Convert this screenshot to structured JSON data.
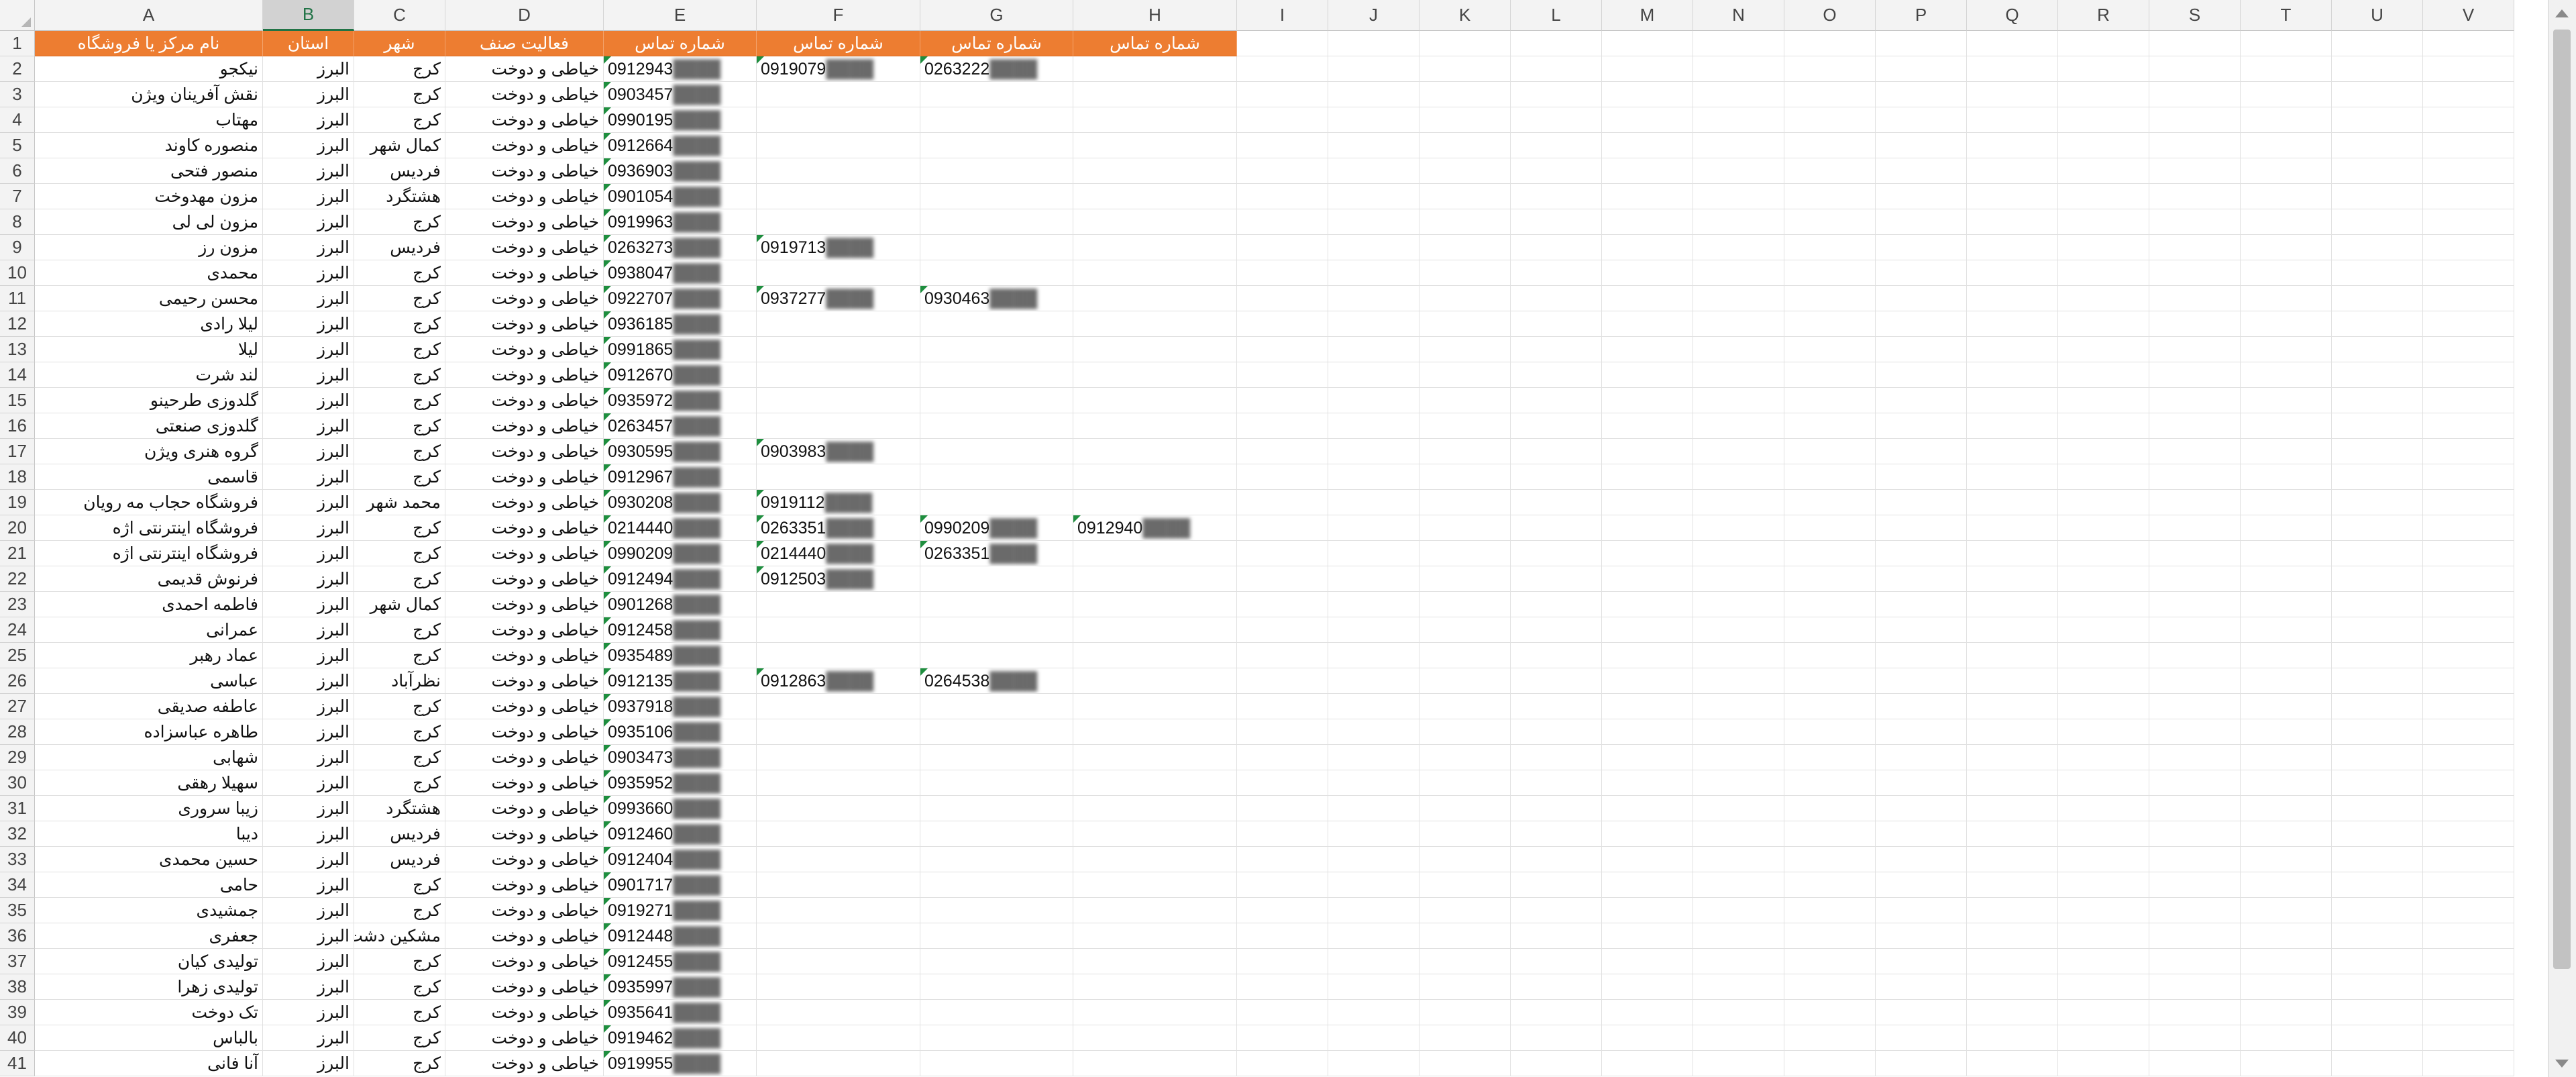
{
  "columns": [
    "A",
    "B",
    "C",
    "D",
    "E",
    "F",
    "G",
    "H",
    "I",
    "J",
    "K",
    "L",
    "M",
    "N",
    "O",
    "P",
    "Q",
    "R",
    "S",
    "T",
    "U",
    "V"
  ],
  "selected_column": "B",
  "header": [
    "نام مرکز یا فروشگاه",
    "استان",
    "شهر",
    "فعالیت صنف",
    "شماره تماس",
    "شماره تماس",
    "شماره تماس",
    "شماره تماس"
  ],
  "rows": [
    {
      "n": "2",
      "a": "نیکجو",
      "b": "البرز",
      "c": "کرج",
      "d": "خیاطی و دوخت",
      "e": "0912943",
      "f": "0919079",
      "g": "0263222",
      "h": ""
    },
    {
      "n": "3",
      "a": "نقش آفرینان ویژن",
      "b": "البرز",
      "c": "کرج",
      "d": "خیاطی و دوخت",
      "e": "0903457",
      "f": "",
      "g": "",
      "h": ""
    },
    {
      "n": "4",
      "a": "مهتاب",
      "b": "البرز",
      "c": "کرج",
      "d": "خیاطی و دوخت",
      "e": "0990195",
      "f": "",
      "g": "",
      "h": ""
    },
    {
      "n": "5",
      "a": "منصوره کاوند",
      "b": "البرز",
      "c": "کمال شهر",
      "d": "خیاطی و دوخت",
      "e": "0912664",
      "f": "",
      "g": "",
      "h": ""
    },
    {
      "n": "6",
      "a": "منصور فتحی",
      "b": "البرز",
      "c": "فردیس",
      "d": "خیاطی و دوخت",
      "e": "0936903",
      "f": "",
      "g": "",
      "h": ""
    },
    {
      "n": "7",
      "a": "مزون مهدوخت",
      "b": "البرز",
      "c": "هشتگرد",
      "d": "خیاطی و دوخت",
      "e": "0901054",
      "f": "",
      "g": "",
      "h": ""
    },
    {
      "n": "8",
      "a": "مزون لی لی",
      "b": "البرز",
      "c": "کرج",
      "d": "خیاطی و دوخت",
      "e": "0919963",
      "f": "",
      "g": "",
      "h": ""
    },
    {
      "n": "9",
      "a": "مزون رز",
      "b": "البرز",
      "c": "فردیس",
      "d": "خیاطی و دوخت",
      "e": "0263273",
      "f": "0919713",
      "g": "",
      "h": ""
    },
    {
      "n": "10",
      "a": "محمدی",
      "b": "البرز",
      "c": "کرج",
      "d": "خیاطی و دوخت",
      "e": "0938047",
      "f": "",
      "g": "",
      "h": ""
    },
    {
      "n": "11",
      "a": "محسن رحیمی",
      "b": "البرز",
      "c": "کرج",
      "d": "خیاطی و دوخت",
      "e": "0922707",
      "f": "0937277",
      "g": "0930463",
      "h": ""
    },
    {
      "n": "12",
      "a": "لیلا رادی",
      "b": "البرز",
      "c": "کرج",
      "d": "خیاطی و دوخت",
      "e": "0936185",
      "f": "",
      "g": "",
      "h": ""
    },
    {
      "n": "13",
      "a": "لیلا",
      "b": "البرز",
      "c": "کرج",
      "d": "خیاطی و دوخت",
      "e": "0991865",
      "f": "",
      "g": "",
      "h": ""
    },
    {
      "n": "14",
      "a": "لند شرت",
      "b": "البرز",
      "c": "کرج",
      "d": "خیاطی و دوخت",
      "e": "0912670",
      "f": "",
      "g": "",
      "h": ""
    },
    {
      "n": "15",
      "a": "گلدوزی طرحینو",
      "b": "البرز",
      "c": "کرج",
      "d": "خیاطی و دوخت",
      "e": "0935972",
      "f": "",
      "g": "",
      "h": ""
    },
    {
      "n": "16",
      "a": "گلدوزی صنعتی",
      "b": "البرز",
      "c": "کرج",
      "d": "خیاطی و دوخت",
      "e": "0263457",
      "f": "",
      "g": "",
      "h": ""
    },
    {
      "n": "17",
      "a": "گروه هنری ویژن",
      "b": "البرز",
      "c": "کرج",
      "d": "خیاطی و دوخت",
      "e": "0930595",
      "f": "0903983",
      "g": "",
      "h": ""
    },
    {
      "n": "18",
      "a": "قاسمی",
      "b": "البرز",
      "c": "کرج",
      "d": "خیاطی و دوخت",
      "e": "0912967",
      "f": "",
      "g": "",
      "h": ""
    },
    {
      "n": "19",
      "a": "فروشگاه حجاب مه رویان",
      "b": "البرز",
      "c": "محمد شهر",
      "d": "خیاطی و دوخت",
      "e": "0930208",
      "f": "0919112",
      "g": "",
      "h": ""
    },
    {
      "n": "20",
      "a": "فروشگاه اینترنتی اژه",
      "b": "البرز",
      "c": "کرج",
      "d": "خیاطی و دوخت",
      "e": "0214440",
      "f": "0263351",
      "g": "0990209",
      "h": "0912940"
    },
    {
      "n": "21",
      "a": "فروشگاه اینترنتی اژه",
      "b": "البرز",
      "c": "کرج",
      "d": "خیاطی و دوخت",
      "e": "0990209",
      "f": "0214440",
      "g": "0263351",
      "h": ""
    },
    {
      "n": "22",
      "a": "فرنوش قدیمی",
      "b": "البرز",
      "c": "کرج",
      "d": "خیاطی و دوخت",
      "e": "0912494",
      "f": "0912503",
      "g": "",
      "h": ""
    },
    {
      "n": "23",
      "a": "فاطمه احمدی",
      "b": "البرز",
      "c": "کمال شهر",
      "d": "خیاطی و دوخت",
      "e": "0901268",
      "f": "",
      "g": "",
      "h": ""
    },
    {
      "n": "24",
      "a": "عمرانی",
      "b": "البرز",
      "c": "کرج",
      "d": "خیاطی و دوخت",
      "e": "0912458",
      "f": "",
      "g": "",
      "h": ""
    },
    {
      "n": "25",
      "a": "عماد رهبر",
      "b": "البرز",
      "c": "کرج",
      "d": "خیاطی و دوخت",
      "e": "0935489",
      "f": "",
      "g": "",
      "h": ""
    },
    {
      "n": "26",
      "a": "عباسی",
      "b": "البرز",
      "c": "نظرآباد",
      "d": "خیاطی و دوخت",
      "e": "0912135",
      "f": "0912863",
      "g": "0264538",
      "h": ""
    },
    {
      "n": "27",
      "a": "عاطفه صدیقی",
      "b": "البرز",
      "c": "کرج",
      "d": "خیاطی و دوخت",
      "e": "0937918",
      "f": "",
      "g": "",
      "h": ""
    },
    {
      "n": "28",
      "a": "طاهره عباسزاده",
      "b": "البرز",
      "c": "کرج",
      "d": "خیاطی و دوخت",
      "e": "0935106",
      "f": "",
      "g": "",
      "h": ""
    },
    {
      "n": "29",
      "a": "شهابی",
      "b": "البرز",
      "c": "کرج",
      "d": "خیاطی و دوخت",
      "e": "0903473",
      "f": "",
      "g": "",
      "h": ""
    },
    {
      "n": "30",
      "a": "سهیلا رهقی",
      "b": "البرز",
      "c": "کرج",
      "d": "خیاطی و دوخت",
      "e": "0935952",
      "f": "",
      "g": "",
      "h": ""
    },
    {
      "n": "31",
      "a": "زیبا سروری",
      "b": "البرز",
      "c": "هشتگرد",
      "d": "خیاطی و دوخت",
      "e": "0993660",
      "f": "",
      "g": "",
      "h": ""
    },
    {
      "n": "32",
      "a": "دیبا",
      "b": "البرز",
      "c": "فردیس",
      "d": "خیاطی و دوخت",
      "e": "0912460",
      "f": "",
      "g": "",
      "h": ""
    },
    {
      "n": "33",
      "a": "حسین محمدی",
      "b": "البرز",
      "c": "فردیس",
      "d": "خیاطی و دوخت",
      "e": "0912404",
      "f": "",
      "g": "",
      "h": ""
    },
    {
      "n": "34",
      "a": "حامی",
      "b": "البرز",
      "c": "کرج",
      "d": "خیاطی و دوخت",
      "e": "0901717",
      "f": "",
      "g": "",
      "h": ""
    },
    {
      "n": "35",
      "a": "جمشیدی",
      "b": "البرز",
      "c": "کرج",
      "d": "خیاطی و دوخت",
      "e": "0919271",
      "f": "",
      "g": "",
      "h": ""
    },
    {
      "n": "36",
      "a": "جعفری",
      "b": "البرز",
      "c": "مشکین دشت",
      "d": "خیاطی و دوخت",
      "e": "0912448",
      "f": "",
      "g": "",
      "h": ""
    },
    {
      "n": "37",
      "a": "تولیدی کیان",
      "b": "البرز",
      "c": "کرج",
      "d": "خیاطی و دوخت",
      "e": "0912455",
      "f": "",
      "g": "",
      "h": ""
    },
    {
      "n": "38",
      "a": "تولیدی زهرا",
      "b": "البرز",
      "c": "کرج",
      "d": "خیاطی و دوخت",
      "e": "0935997",
      "f": "",
      "g": "",
      "h": ""
    },
    {
      "n": "39",
      "a": "تک دوخت",
      "b": "البرز",
      "c": "کرج",
      "d": "خیاطی و دوخت",
      "e": "0935641",
      "f": "",
      "g": "",
      "h": ""
    },
    {
      "n": "40",
      "a": "بالباس",
      "b": "البرز",
      "c": "کرج",
      "d": "خیاطی و دوخت",
      "e": "0919462",
      "f": "",
      "g": "",
      "h": ""
    },
    {
      "n": "41",
      "a": "آنا فانی",
      "b": "البرز",
      "c": "کرج",
      "d": "خیاطی و دوخت",
      "e": "0919955",
      "f": "",
      "g": "",
      "h": ""
    }
  ]
}
